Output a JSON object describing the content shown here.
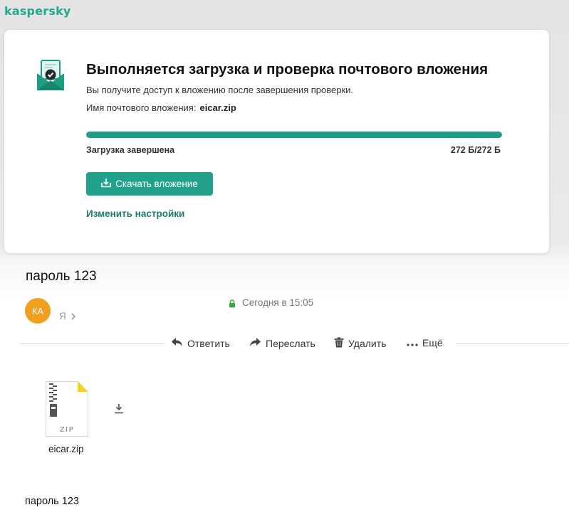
{
  "kaspersky": {
    "logo": "kaspersky",
    "title": "Выполняется загрузка и проверка почтового вложения",
    "subtitle": "Вы получите доступ к вложению после завершения проверки.",
    "attachment_label": "Имя почтового вложения:",
    "attachment_name": "eicar.zip",
    "progress_percent": 100,
    "status": "Загрузка завершена",
    "size": "272 Б/272 Б",
    "download_button": "Скачать вложение",
    "settings_link": "Изменить настройки",
    "accent_color": "#1c9d84"
  },
  "email": {
    "subject": "пароль 123",
    "avatar_initials": "КА",
    "date": "Сегодня в 15:05",
    "to": "Я",
    "actions": {
      "reply": "Ответить",
      "forward": "Переслать",
      "delete": "Удалить",
      "more": "Ещё"
    },
    "attachment": {
      "type": "ZIP",
      "name": "eicar.zip"
    },
    "body": "пароль 123"
  }
}
